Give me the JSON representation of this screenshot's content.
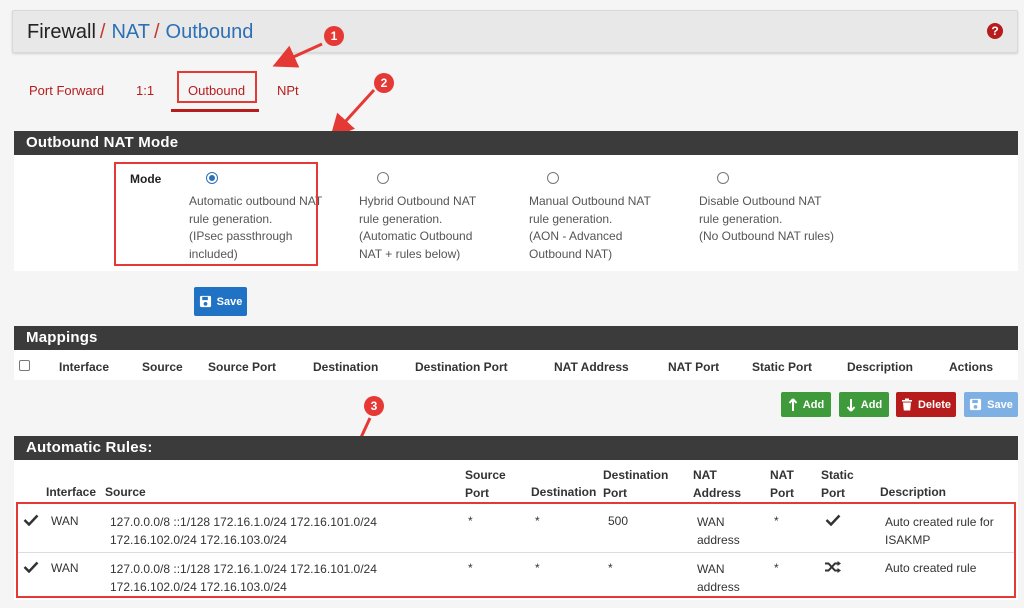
{
  "breadcrumb": {
    "firewall": "Firewall",
    "nat": "NAT",
    "outbound": "Outbound",
    "sep": "/"
  },
  "tabs": [
    {
      "label": "Port Forward"
    },
    {
      "label": "1:1"
    },
    {
      "label": "Outbound"
    },
    {
      "label": "NPt"
    }
  ],
  "callouts": [
    "1",
    "2",
    "3"
  ],
  "outbound_mode": {
    "title": "Outbound NAT Mode",
    "mode_label": "Mode",
    "options": [
      {
        "lines": [
          "Automatic outbound NAT",
          "rule generation.",
          "(IPsec passthrough",
          "included)"
        ],
        "checked": true
      },
      {
        "lines": [
          "Hybrid Outbound NAT",
          "rule generation.",
          "(Automatic Outbound",
          "NAT + rules below)"
        ],
        "checked": false
      },
      {
        "lines": [
          "Manual Outbound NAT",
          "rule generation.",
          "(AON - Advanced",
          "Outbound NAT)"
        ],
        "checked": false
      },
      {
        "lines": [
          "Disable Outbound NAT",
          "rule generation.",
          "(No Outbound NAT rules)"
        ],
        "checked": false
      }
    ],
    "save_label": "Save"
  },
  "mappings": {
    "title": "Mappings",
    "columns": [
      "Interface",
      "Source",
      "Source Port",
      "Destination",
      "Destination Port",
      "NAT Address",
      "NAT Port",
      "Static Port",
      "Description",
      "Actions"
    ],
    "buttons": {
      "add_top": "Add",
      "add_bottom": "Add",
      "delete": "Delete",
      "save": "Save"
    }
  },
  "automatic_rules": {
    "title": "Automatic Rules:",
    "columns": {
      "interface": "Interface",
      "source": "Source",
      "source_port": [
        "Source",
        "Port"
      ],
      "destination": "Destination",
      "destination_port": [
        "Destination",
        "Port"
      ],
      "nat_address": [
        "NAT",
        "Address"
      ],
      "nat_port": [
        "NAT",
        "Port"
      ],
      "static_port": [
        "Static",
        "Port"
      ],
      "description": "Description"
    },
    "rows": [
      {
        "interface": "WAN",
        "source": [
          "127.0.0.0/8 ::1/128 172.16.1.0/24 172.16.101.0/24",
          "172.16.102.0/24 172.16.103.0/24"
        ],
        "source_port": "*",
        "destination": "*",
        "destination_port": "500",
        "nat_address": [
          "WAN",
          "address"
        ],
        "nat_port": "*",
        "static_port_icon": "check-icon",
        "description": [
          "Auto created rule for",
          "ISAKMP"
        ]
      },
      {
        "interface": "WAN",
        "source": [
          "127.0.0.0/8 ::1/128 172.16.1.0/24 172.16.101.0/24",
          "172.16.102.0/24 172.16.103.0/24"
        ],
        "source_port": "*",
        "destination": "*",
        "destination_port": "*",
        "nat_address": [
          "WAN",
          "address"
        ],
        "nat_port": "*",
        "static_port_icon": "shuffle-icon",
        "description": [
          "Auto created rule"
        ]
      }
    ]
  },
  "colors": {
    "accent_red": "#b71c1c",
    "link_blue": "#2c70b5",
    "header_dark": "#3b3b3b",
    "annotation_red": "#e53935"
  }
}
